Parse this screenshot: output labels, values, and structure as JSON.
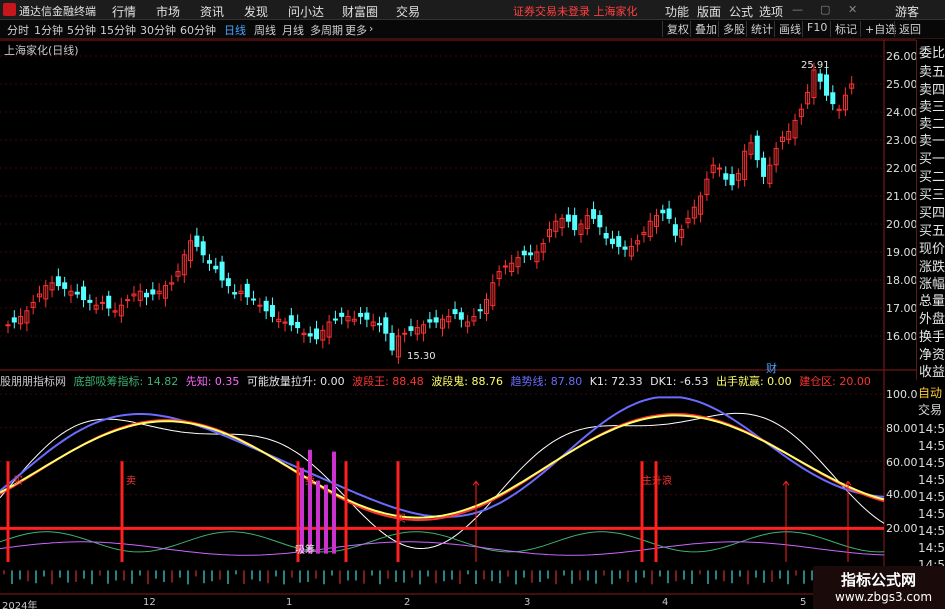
{
  "topbar": {
    "app_name": "通达信金融终端",
    "menus": [
      "行情",
      "市场",
      "资讯",
      "发现",
      "问小达",
      "财富圈",
      "交易"
    ],
    "status": "证券交易未登录  上海家化",
    "right_menus": [
      "功能",
      "版面",
      "公式",
      "选项"
    ],
    "guest": "游客"
  },
  "toolbar": {
    "periods": [
      "分时",
      "1分钟",
      "5分钟",
      "15分钟",
      "30分钟",
      "60分钟",
      "日线",
      "周线",
      "月线",
      "多周期",
      "更多"
    ],
    "active_period": "日线",
    "buttons": [
      "复权",
      "叠加",
      "多股",
      "统计",
      "画线",
      "F10",
      "标记",
      "+自选",
      "返回"
    ]
  },
  "main_chart": {
    "title": "上海家化(日线)",
    "high_label": "25.91",
    "low_label": "15.30",
    "marker": "财",
    "y_ticks": [
      "26.00",
      "25.00",
      "24.00",
      "23.00",
      "22.00",
      "21.00",
      "20.00",
      "19.00",
      "18.00",
      "17.00",
      "16.00"
    ]
  },
  "right_panel": {
    "items": [
      "委比",
      "卖五",
      "卖四",
      "卖三",
      "卖二",
      "卖一",
      "买一",
      "买二",
      "买三",
      "买四",
      "买五",
      "现价",
      "涨跌",
      "涨幅",
      "总量",
      "外盘",
      "换手",
      "净资",
      "收益"
    ]
  },
  "right_panel2": {
    "items": [
      "自动",
      "交易",
      "14:56",
      "14:56",
      "14:56",
      "14:56",
      "14:56",
      "14:56",
      "14:56",
      "14:56",
      "14:56"
    ]
  },
  "indicator": {
    "name": "股朋朋指标网",
    "fields": [
      {
        "label": "底部吸筹指标: 14.82",
        "color": "#3cb371"
      },
      {
        "label": "先知: 0.35",
        "color": "#ff66ff"
      },
      {
        "label": "可能放量拉升: 0.00",
        "color": "#e6e6e6"
      },
      {
        "label": "波段王: 88.48",
        "color": "#ff3333"
      },
      {
        "label": "波段鬼: 88.76",
        "color": "#ffff66"
      },
      {
        "label": "趋势线: 87.80",
        "color": "#6b6bff"
      },
      {
        "label": "K1: 72.33",
        "color": "#e6e6e6"
      },
      {
        "label": "DK1: -6.53",
        "color": "#e6e6e6"
      },
      {
        "label": "出手就赢: 0.00",
        "color": "#ffff66"
      },
      {
        "label": "建仓区: 20.00",
        "color": "#ff3333"
      }
    ],
    "y_ticks": [
      "100.0",
      "80.00",
      "60.00",
      "40.00",
      "20.00"
    ],
    "tags": [
      "买",
      "卖",
      "卖",
      "买",
      "吸筹",
      "主升浪"
    ]
  },
  "xaxis": [
    "2024年",
    "12",
    "1",
    "2",
    "3",
    "4",
    "5"
  ],
  "watermark": {
    "line1": "指标公式网",
    "line2": "www.zbgs3.com"
  },
  "colors": {
    "up": "#ff3232",
    "down": "#54ffff",
    "grid": "#3a0a0a",
    "axis": "#8b1a1a"
  }
}
